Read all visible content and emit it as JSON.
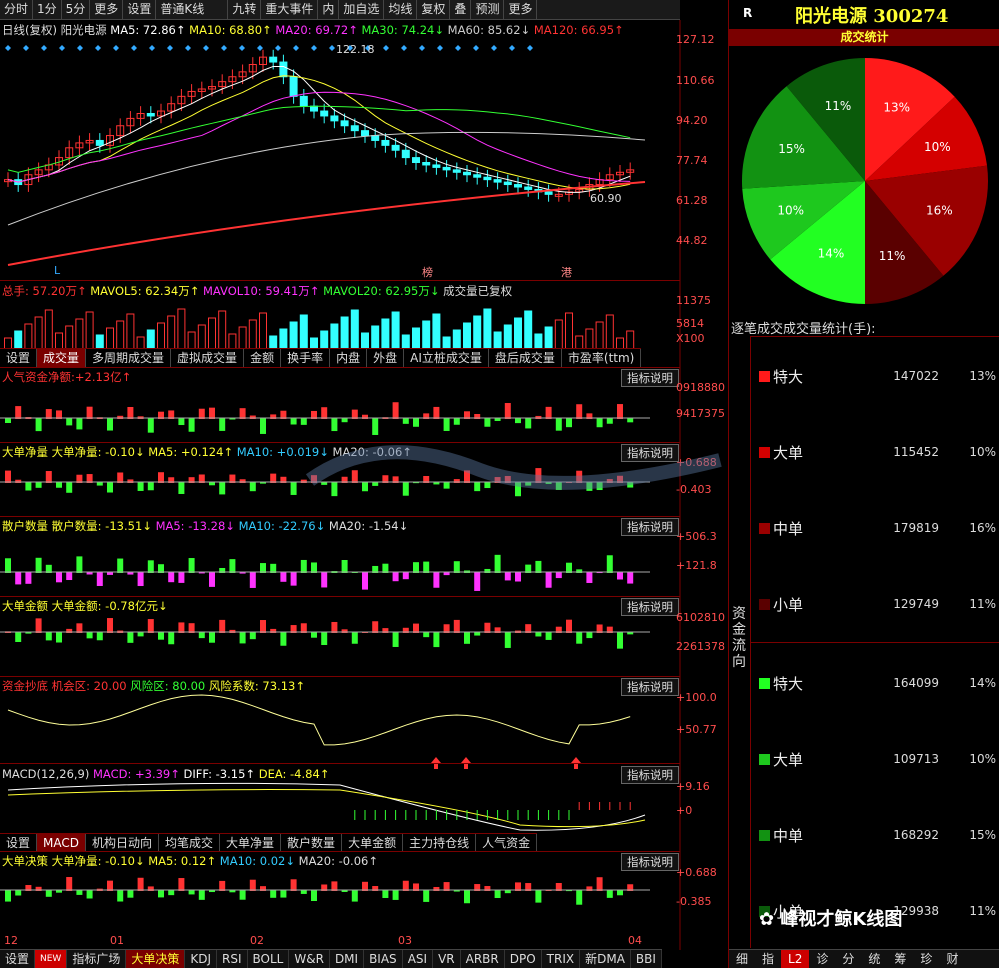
{
  "toolbar": {
    "items": [
      "分时",
      "1分",
      "5分",
      "更多",
      "设置",
      "普通K线",
      "九转",
      "重大事件",
      "内",
      "加自选",
      "均线",
      "复权",
      "叠",
      "预测",
      "更多"
    ]
  },
  "stock": {
    "header_left": "R",
    "title": "阳光电源 300274"
  },
  "main_chart": {
    "legend": {
      "label": "日线(复权)",
      "name": "阳光电源",
      "ma5": "MA5: 72.86↑",
      "ma10": "MA10: 68.80↑",
      "ma20": "MA20: 69.72↑",
      "ma30": "MA30: 74.24↓",
      "ma60": "MA60: 85.62↓",
      "ma120": "MA120: 66.95↑"
    },
    "price_ticks": [
      "127.12",
      "110.66",
      "94.20",
      "77.74",
      "61.28",
      "44.82"
    ],
    "high_label": "122.18",
    "low_label": "60.90",
    "markers": [
      "L",
      "榜",
      "港"
    ]
  },
  "volume": {
    "legend": {
      "total": "总手: 57.20万↑",
      "mavol5": "MAVOL5: 62.34万↑",
      "mavol10": "MAVOL10: 59.41万↑",
      "mavol20": "MAVOL20: 62.95万↓",
      "note": "成交量已复权"
    },
    "ticks": [
      "11375",
      "5814",
      "X100"
    ]
  },
  "tabs1": [
    "设置",
    "成交量",
    "多周期成交量",
    "虚拟成交量",
    "金额",
    "换手率",
    "内盘",
    "外盘",
    "AI立桩成交量",
    "盘后成交量",
    "市盈率(ttm)"
  ],
  "panels": {
    "p1": {
      "title": "人气资金净额:",
      "value": "+2.13亿↑",
      "btn": "指标说明",
      "ticks": [
        "0918880",
        "9417375"
      ]
    },
    "p2": {
      "title": "大单净量",
      "t2": "大单净量: -0.10↓",
      "ma5": "MA5: +0.124↑",
      "ma10": "MA10: +0.019↓",
      "ma20": "MA20: -0.06↑",
      "btn": "指标说明",
      "ticks": [
        "+0.688",
        "-0.403"
      ]
    },
    "p3": {
      "title": "散户数量",
      "t2": "散户数量: -13.51↓",
      "ma5": "MA5: -13.28↓",
      "ma10": "MA10: -22.76↓",
      "ma20": "MA20: -1.54↓",
      "btn": "指标说明",
      "ticks": [
        "+506.3",
        "+121.8"
      ]
    },
    "p4": {
      "title": "大单金额",
      "t2": "大单金额: -0.78亿元↓",
      "btn": "指标说明",
      "ticks": [
        "6102810",
        "2261378"
      ]
    },
    "p5": {
      "title": "资金抄底",
      "opp": "机会区: 20.00",
      "risk": "风险区: 80.00",
      "coef": "风险系数: 73.13↑",
      "btn": "指标说明",
      "ticks": [
        "+100.0",
        "+50.77"
      ]
    },
    "p6": {
      "title": "MACD(12,26,9)",
      "macd": "MACD: +3.39↑",
      "diff": "DIFF: -3.15↑",
      "dea": "DEA: -4.84↑",
      "btn": "指标说明",
      "ticks": [
        "+9.16",
        "+0"
      ]
    },
    "p7": {
      "title": "大单决策",
      "t2": "大单净量: -0.10↓",
      "ma5": "MA5: 0.12↑",
      "ma10": "MA10: 0.02↓",
      "ma20": "MA20: -0.06↑",
      "btn": "指标说明",
      "ticks": [
        "+0.688",
        "-0.385"
      ]
    }
  },
  "tabs2": [
    "设置",
    "MACD",
    "机构日动向",
    "均笔成交",
    "大单净量",
    "散户数量",
    "大单金额",
    "主力持仓线",
    "人气资金"
  ],
  "dates": [
    "12",
    "01",
    "02",
    "03",
    "04"
  ],
  "bottom_tabs": [
    "设置",
    "NEW",
    "指标广场",
    "大单决策",
    "KDJ",
    "RSI",
    "BOLL",
    "W&R",
    "DMI",
    "BIAS",
    "ASI",
    "VR",
    "ARBR",
    "DPO",
    "TRIX",
    "新DMA",
    "BBI"
  ],
  "right_panel": {
    "pie_title": "成交统计",
    "list_title": "逐笔成交成交量统计(手):",
    "side_label": "资金流向",
    "rows": [
      {
        "name": "特大",
        "value": "147022",
        "pct": "13%",
        "color": "#ff1a1a"
      },
      {
        "name": "大单",
        "value": "115452",
        "pct": "10%",
        "color": "#d40000"
      },
      {
        "name": "中单",
        "value": "179819",
        "pct": "16%",
        "color": "#9a0000"
      },
      {
        "name": "小单",
        "value": "129749",
        "pct": "11%",
        "color": "#5a0000"
      },
      {
        "name": "特大",
        "value": "164099",
        "pct": "14%",
        "color": "#22ff22"
      },
      {
        "name": "大单",
        "value": "109713",
        "pct": "10%",
        "color": "#1ec81e"
      },
      {
        "name": "中单",
        "value": "168292",
        "pct": "15%",
        "color": "#129212"
      },
      {
        "name": "小单",
        "value": "129938",
        "pct": "11%",
        "color": "#0a5a0a"
      }
    ],
    "bottom_tabs": [
      "细",
      "指",
      "L2",
      "诊",
      "分",
      "统",
      "筹",
      "珍",
      "财"
    ],
    "watermark": "峰视才鲸K线图"
  }
}
